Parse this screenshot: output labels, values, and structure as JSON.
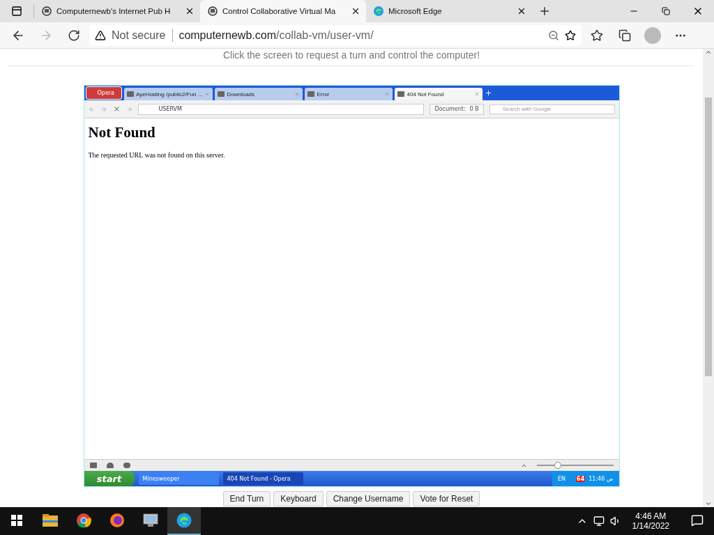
{
  "browser_tabs": [
    {
      "title": "Computernewb's Internet Pub H",
      "selected": false,
      "kind": "site"
    },
    {
      "title": "Control Collaborative Virtual Ma",
      "selected": true,
      "kind": "site"
    },
    {
      "title": "Microsoft Edge",
      "selected": false,
      "kind": "edge"
    }
  ],
  "address_bar": {
    "security": "Not secure",
    "url_domain": "computernewb.com",
    "url_path": "/collab-vm/user-vm/"
  },
  "page": {
    "instructions": "Click the screen to request a turn and control the computer!"
  },
  "vm": {
    "opera_menu": "Opera",
    "tabs": [
      {
        "title": "AyeHosting /public2/Fun ...",
        "selected": false
      },
      {
        "title": "Downloads",
        "selected": false
      },
      {
        "title": "Error",
        "selected": false
      },
      {
        "title": "404 Not Found",
        "selected": true
      }
    ],
    "address": "USERVM",
    "document_label": "Document:",
    "document_size": "0 B",
    "search_placeholder": "Search with Google",
    "heading": "Not Found",
    "message": "The requested URL was not found on this server.",
    "zoom": {
      "level": 0.27
    },
    "taskbar": {
      "start": "start",
      "windows": [
        {
          "title": "Minesweeper",
          "selected": false
        },
        {
          "title": "404 Not Found - Opera",
          "selected": true
        }
      ],
      "language": "EN",
      "badge": "64",
      "clock": "11:46 ص"
    }
  },
  "vm_buttons": [
    "End Turn",
    "Keyboard",
    "Change Username",
    "Vote for Reset"
  ],
  "taskbar": {
    "apps": [
      {
        "kind": "folder",
        "active": false
      },
      {
        "kind": "chrome",
        "active": false
      },
      {
        "kind": "firefox",
        "active": false
      },
      {
        "kind": "vm",
        "active": false
      },
      {
        "kind": "edge",
        "active": true
      }
    ],
    "time": "4:46 AM",
    "date": "1/14/2022"
  }
}
